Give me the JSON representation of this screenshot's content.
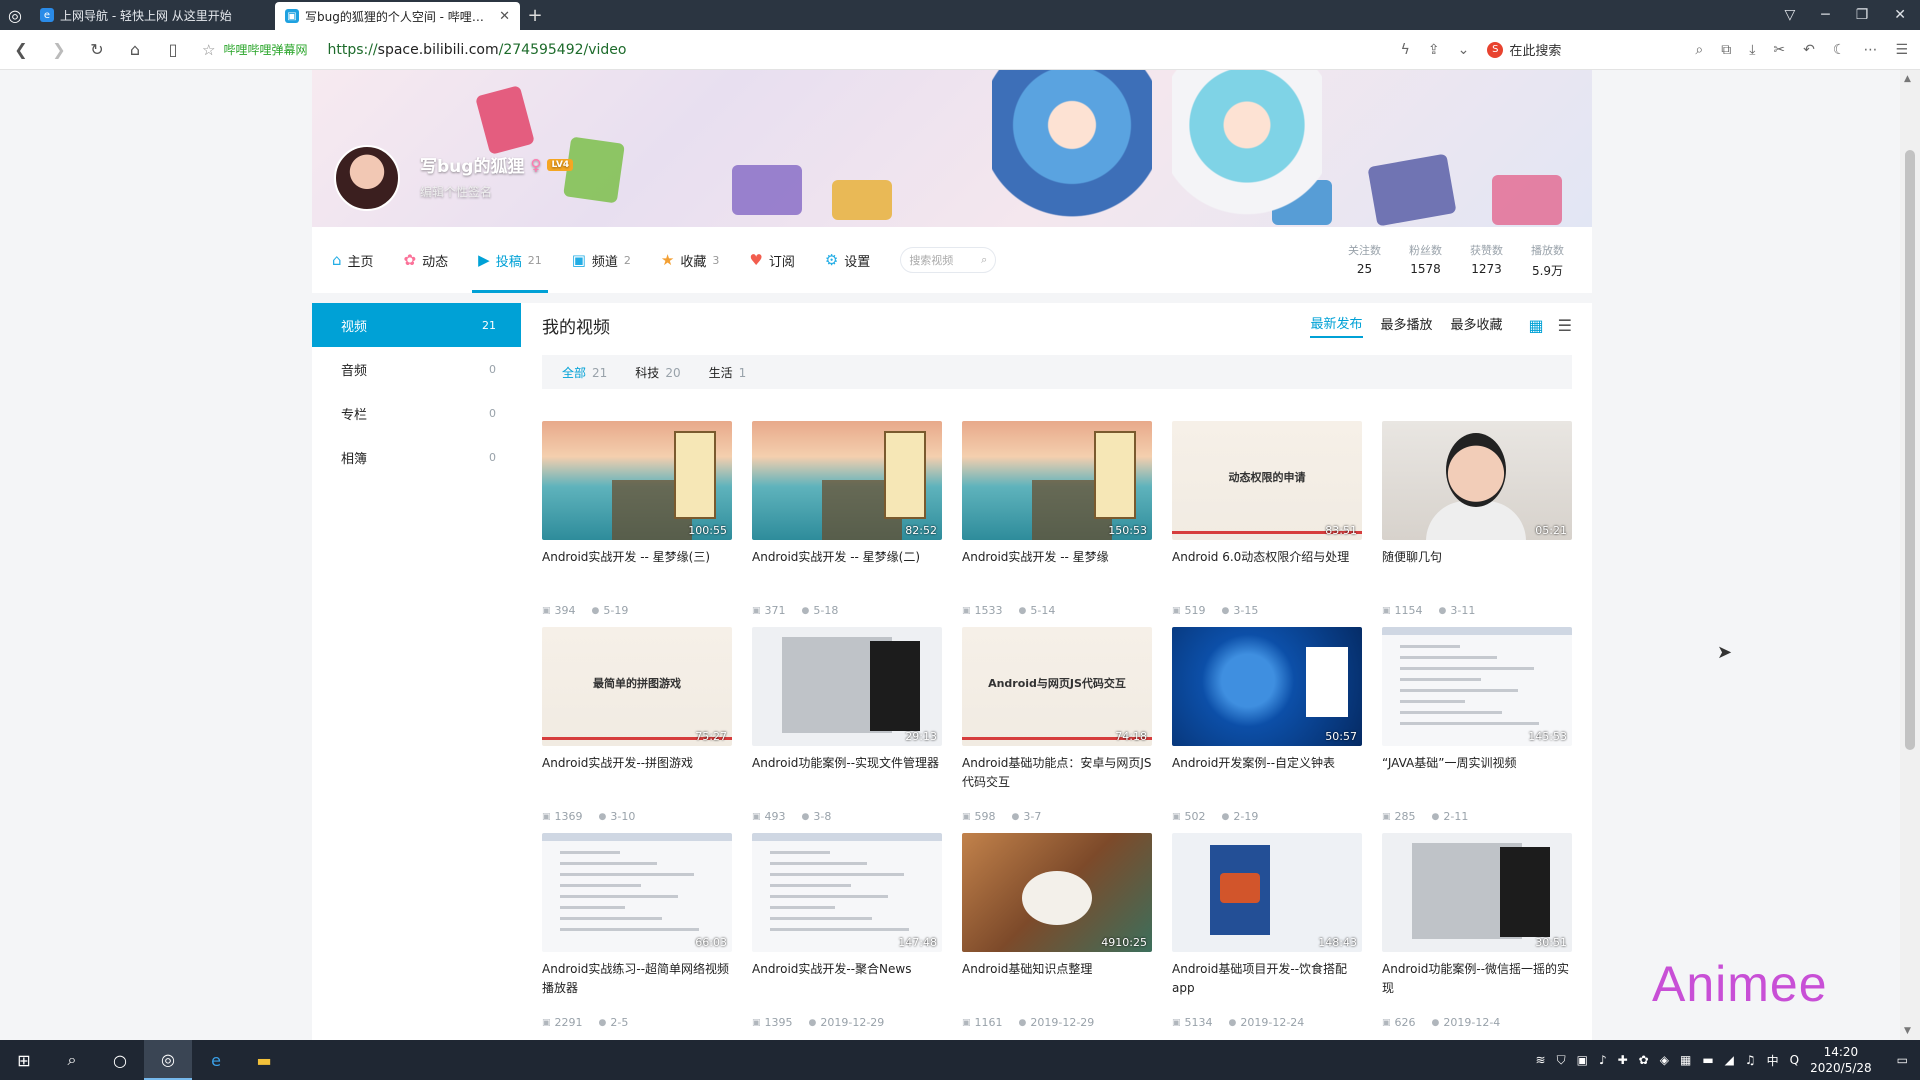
{
  "browser": {
    "tabs": [
      {
        "title": "上网导航 - 轻快上网 从这里开始",
        "active": false
      },
      {
        "title": "写bug的狐狸的个人空间 - 哔哩哔哩",
        "active": true
      }
    ],
    "url_scheme": "https://",
    "url_host": "space.bilibili.com",
    "url_path": "/274595492/video",
    "site_tag": "哔哩哔哩弹幕网",
    "search_placeholder": "在此搜索"
  },
  "profile": {
    "name": "写bug的狐狸",
    "level": "LV4",
    "signature": "编辑个性签名"
  },
  "nav": {
    "items": [
      {
        "label": "主页",
        "count": "",
        "icon": "home-icon",
        "active": false
      },
      {
        "label": "动态",
        "count": "",
        "icon": "dynamic-icon",
        "active": false
      },
      {
        "label": "投稿",
        "count": "21",
        "icon": "upload-icon",
        "active": true
      },
      {
        "label": "频道",
        "count": "2",
        "icon": "channel-icon",
        "active": false
      },
      {
        "label": "收藏",
        "count": "3",
        "icon": "star-icon",
        "active": false
      },
      {
        "label": "订阅",
        "count": "",
        "icon": "heart-icon",
        "active": false
      },
      {
        "label": "设置",
        "count": "",
        "icon": "gear-icon",
        "active": false
      }
    ],
    "search_placeholder": "搜索视频"
  },
  "stats": [
    {
      "label": "关注数",
      "value": "25"
    },
    {
      "label": "粉丝数",
      "value": "1578"
    },
    {
      "label": "获赞数",
      "value": "1273"
    },
    {
      "label": "播放数",
      "value": "5.9万"
    }
  ],
  "sidebar": {
    "items": [
      {
        "label": "视频",
        "count": "21",
        "active": true
      },
      {
        "label": "音频",
        "count": "0",
        "active": false
      },
      {
        "label": "专栏",
        "count": "0",
        "active": false
      },
      {
        "label": "相簿",
        "count": "0",
        "active": false
      }
    ]
  },
  "main": {
    "title": "我的视频",
    "sorts": [
      {
        "label": "最新发布",
        "active": true
      },
      {
        "label": "最多播放",
        "active": false
      },
      {
        "label": "最多收藏",
        "active": false
      }
    ],
    "filters": [
      {
        "label": "全部",
        "count": "21",
        "active": true
      },
      {
        "label": "科技",
        "count": "20",
        "active": false
      },
      {
        "label": "生活",
        "count": "1",
        "active": false
      }
    ],
    "videos": [
      {
        "title": "Android实战开发 -- 星梦缘(三)",
        "duration": "100:55",
        "plays": "394",
        "date": "5-19",
        "thumb": "sea"
      },
      {
        "title": "Android实战开发 -- 星梦缘(二)",
        "duration": "82:52",
        "plays": "371",
        "date": "5-18",
        "thumb": "sea"
      },
      {
        "title": "Android实战开发 -- 星梦缘",
        "duration": "150:53",
        "plays": "1533",
        "date": "5-14",
        "thumb": "sea"
      },
      {
        "title": "Android 6.0动态权限介绍与处理",
        "duration": "83:51",
        "plays": "519",
        "date": "3-15",
        "thumb": "slide",
        "thumb_text": "动态权限的申请"
      },
      {
        "title": "随便聊几句",
        "duration": "05:21",
        "plays": "1154",
        "date": "3-11",
        "thumb": "face"
      },
      {
        "title": "Android实战开发--拼图游戏",
        "duration": "75:27",
        "plays": "1369",
        "date": "3-10",
        "thumb": "slide",
        "thumb_text": "最简单的拼图游戏"
      },
      {
        "title": "Android功能案例--实现文件管理器",
        "duration": "29:13",
        "plays": "493",
        "date": "3-8",
        "thumb": "ide"
      },
      {
        "title": "Android基础功能点：安卓与网页JS代码交互",
        "duration": "74:18",
        "plays": "598",
        "date": "3-7",
        "thumb": "slide",
        "thumb_text": "Android与网页JS代码交互"
      },
      {
        "title": "Android开发案例--自定义钟表",
        "duration": "50:57",
        "plays": "502",
        "date": "2-19",
        "thumb": "win10"
      },
      {
        "title": "“JAVA基础”一周实训视频",
        "duration": "145:53",
        "plays": "285",
        "date": "2-11",
        "thumb": "doc"
      },
      {
        "title": "Android实战练习--超简单网络视频播放器",
        "duration": "66:03",
        "plays": "2291",
        "date": "2-5",
        "thumb": "doc"
      },
      {
        "title": "Android实战开发--聚合News",
        "duration": "147:48",
        "plays": "1395",
        "date": "2019-12-29",
        "thumb": "doc"
      },
      {
        "title": "Android基础知识点整理",
        "duration": "4910:25",
        "plays": "1161",
        "date": "2019-12-29",
        "thumb": "room"
      },
      {
        "title": "Android基础项目开发--饮食搭配app",
        "duration": "148:43",
        "plays": "5134",
        "date": "2019-12-24",
        "thumb": "app"
      },
      {
        "title": "Android功能案例--微信摇一摇的实现",
        "duration": "30:51",
        "plays": "626",
        "date": "2019-12-4",
        "thumb": "ide"
      }
    ]
  },
  "watermark": "Animee",
  "taskbar": {
    "time": "14:20",
    "date": "2020/5/28",
    "ime": "中"
  },
  "colors": {
    "accent": "#00a1d6",
    "tabbar": "#2b3541",
    "taskbar": "#1f2733"
  }
}
